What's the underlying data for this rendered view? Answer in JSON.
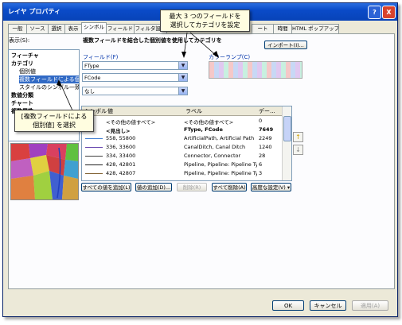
{
  "window": {
    "title": "レイヤ プロパティ",
    "help_icon": "?",
    "close_icon": "X"
  },
  "tabs": [
    "一般",
    "ソース",
    "選択",
    "表示",
    "シンボル",
    "フィールド",
    "フィルタ設定",
    "",
    "",
    "ート",
    "時間",
    "HTML ポップアップ"
  ],
  "panel": {
    "show_label": "表示(S):",
    "tree": [
      "フィーチャ",
      "カテゴリ",
      "個別値",
      "複数フィールドによる個別値",
      "スタイルのシンボル一致",
      "数値分類",
      "チャート",
      "複数属性"
    ],
    "heading": "複数フィールドを結合した個別値を使用してカテゴリを",
    "import_button": "インポート(I)...",
    "fields_label": "フィールド(F)",
    "color_label": "カラーランプ(C)",
    "field_values": [
      "FType",
      "FCode",
      "なし"
    ],
    "grid": {
      "headers": [
        "シンボル",
        "値",
        "ラベル",
        "デー..."
      ],
      "rows": [
        {
          "value": "<その他の値すべて>",
          "label": "<その他の値すべて>",
          "count": "0"
        },
        {
          "value": "<見出し>",
          "label": "FType, FCode",
          "count": "7649"
        },
        {
          "value": "558, 55800",
          "label": "ArtificialPath, Artificial Path",
          "count": "2249"
        },
        {
          "value": "336, 33600",
          "label": "CanalDitch, Canal Ditch",
          "count": "1240"
        },
        {
          "value": "334, 33400",
          "label": "Connector, Connector",
          "count": "28"
        },
        {
          "value": "428, 42801",
          "label": "Pipeline, Pipeline: Pipeline Type",
          "count": "6"
        },
        {
          "value": "428, 42807",
          "label": "Pipeline, Pipeline: Pipeline Type",
          "count": "3"
        }
      ]
    },
    "buttons": {
      "add_all": "すべての値を追加(L)",
      "add_values": "値の追加(D)...",
      "remove": "削除(R)",
      "remove_all": "すべて削除(A)",
      "advanced": "高度な設定(V) ▾"
    }
  },
  "callouts": {
    "top_line1": "最大 3 つのフィールドを",
    "top_line2": "選択してカテゴリを設定",
    "left_line1": "[複数フィールドによる",
    "left_line2": "個別値] を選択"
  },
  "footer": {
    "ok": "OK",
    "cancel": "キャンセル",
    "apply": "適用(A)"
  },
  "colors": {
    "titlebar": "#0a4bc8",
    "selection": "#316ac5"
  }
}
